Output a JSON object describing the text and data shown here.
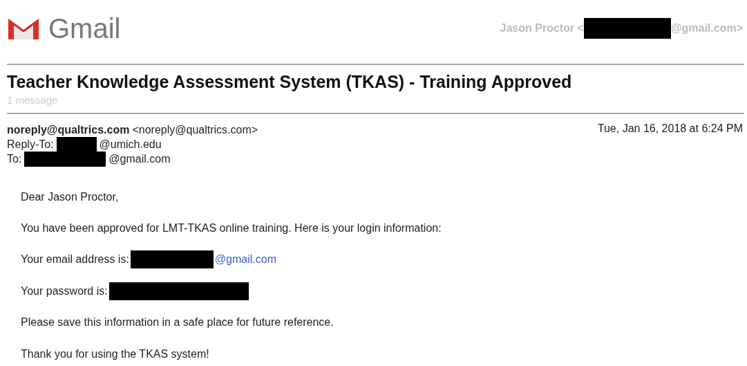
{
  "header": {
    "logo_text": "Gmail",
    "account": {
      "name": "Jason Proctor <",
      "suffix": "@gmail.com>"
    }
  },
  "thread": {
    "subject": "Teacher Knowledge Assessment System (TKAS) - Training Approved",
    "count": "1 message"
  },
  "message": {
    "from_name": "noreply@qualtrics.com",
    "from_address": "<noreply@qualtrics.com>",
    "date": "Tue, Jan 16, 2018 at 6:24 PM",
    "reply_to": {
      "label": "Reply-To:",
      "suffix": "@umich.edu"
    },
    "to": {
      "label": "To:",
      "suffix": "@gmail.com"
    },
    "body": [
      {
        "kind": "text",
        "text": "Dear Jason Proctor,"
      },
      {
        "kind": "text",
        "text": "You have been approved for LMT-TKAS online training. Here is your login information:"
      },
      {
        "kind": "redacted_link",
        "text": "Your email address is:",
        "link": "@gmail.com"
      },
      {
        "kind": "redacted",
        "text": "Your password is:"
      },
      {
        "kind": "text",
        "text": "Please save this information in a safe place for future reference."
      },
      {
        "kind": "text",
        "text": "Thank you for using the TKAS system!"
      }
    ]
  }
}
